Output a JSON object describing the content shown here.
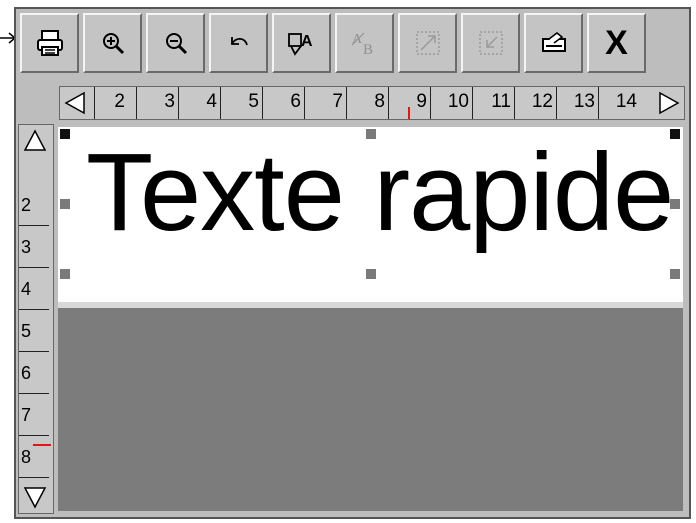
{
  "toolbar": {
    "buttons": [
      {
        "icon": "printer-icon",
        "enabled": true
      },
      {
        "icon": "zoom-in-icon",
        "enabled": true
      },
      {
        "icon": "zoom-out-icon",
        "enabled": true
      },
      {
        "icon": "undo-icon",
        "enabled": true
      },
      {
        "icon": "text-properties-icon",
        "enabled": true
      },
      {
        "icon": "text-style-icon",
        "enabled": false
      },
      {
        "icon": "resize-frame-icon",
        "enabled": false
      },
      {
        "icon": "fit-frame-icon",
        "enabled": false
      },
      {
        "icon": "print-preview-icon",
        "enabled": true
      },
      {
        "icon": "close-icon",
        "enabled": true
      }
    ],
    "close_label": "X"
  },
  "horizontal_ruler": {
    "ticks": [
      "2",
      "3",
      "4",
      "5",
      "6",
      "7",
      "8",
      "9",
      "10",
      "11",
      "12",
      "13",
      "14"
    ]
  },
  "vertical_ruler": {
    "ticks": [
      "2",
      "3",
      "4",
      "5",
      "6",
      "7",
      "8"
    ]
  },
  "label": {
    "text": "Texte rapide"
  },
  "colors": {
    "marker": "#e11111",
    "canvas_background": "#7c7c7c",
    "toolbar_background": "#c4c4c4"
  }
}
